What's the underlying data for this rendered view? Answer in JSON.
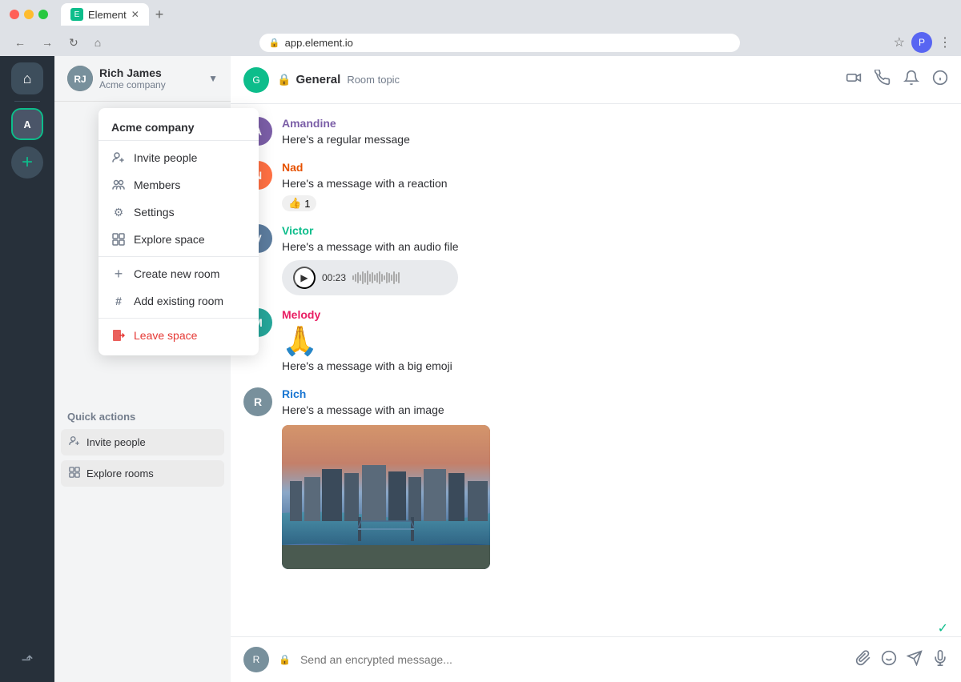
{
  "browser": {
    "url": "app.element.io",
    "tab_title": "Element",
    "tab_favicon": "E"
  },
  "header": {
    "room_name": "General",
    "room_topic": "Room topic",
    "room_icon_color": "#0DBD8B"
  },
  "sidebar": {
    "user_name": "Rich James",
    "user_company": "Acme company",
    "chevron": "▼"
  },
  "dropdown": {
    "title": "Acme company",
    "items": [
      {
        "id": "invite-people",
        "label": "Invite people",
        "icon": "👤"
      },
      {
        "id": "members",
        "label": "Members",
        "icon": "⊕"
      },
      {
        "id": "settings",
        "label": "Settings",
        "icon": "⚙"
      },
      {
        "id": "explore-space",
        "label": "Explore space",
        "icon": "⊞"
      },
      {
        "id": "create-new-room",
        "label": "Create new room",
        "icon": "+"
      },
      {
        "id": "add-existing-room",
        "label": "Add existing room",
        "icon": "#"
      },
      {
        "id": "leave-space",
        "label": "Leave space",
        "icon": "🚪",
        "danger": true
      }
    ]
  },
  "quick_actions": {
    "title": "Quick actions",
    "items": [
      {
        "id": "invite-people-qa",
        "label": "Invite people",
        "icon": "👤"
      },
      {
        "id": "explore-rooms-qa",
        "label": "Explore rooms",
        "icon": "⊞"
      }
    ]
  },
  "messages": [
    {
      "id": "msg1",
      "sender": "Amandine",
      "sender_color": "#7b5ea7",
      "avatar_bg": "#7b5ea7",
      "avatar_letter": "A",
      "text": "Here's a regular message",
      "type": "text"
    },
    {
      "id": "msg2",
      "sender": "Nad",
      "sender_color": "#e65100",
      "avatar_bg": "#ff7043",
      "avatar_letter": "N",
      "text": "Here's a message with a reaction",
      "type": "reaction",
      "reaction_emoji": "👍",
      "reaction_count": "1"
    },
    {
      "id": "msg3",
      "sender": "Victor",
      "sender_color": "#0DBD8B",
      "avatar_bg": "#5c7c9e",
      "avatar_letter": "V",
      "text": "Here's a message with an audio file",
      "type": "audio",
      "audio_time": "00:23"
    },
    {
      "id": "msg4",
      "sender": "Melody",
      "sender_color": "#e91e63",
      "avatar_bg": "#26a69a",
      "avatar_letter": "M",
      "text": "Here's a message with a big emoji",
      "type": "emoji",
      "emoji": "🙏"
    },
    {
      "id": "msg5",
      "sender": "Rich",
      "sender_color": "#1976d2",
      "avatar_bg": "#78909c",
      "avatar_letter": "R",
      "text": "Here's a message with an image",
      "type": "image"
    }
  ],
  "chat_input": {
    "placeholder": "Send an encrypted message...",
    "lock_icon": "🔒"
  }
}
